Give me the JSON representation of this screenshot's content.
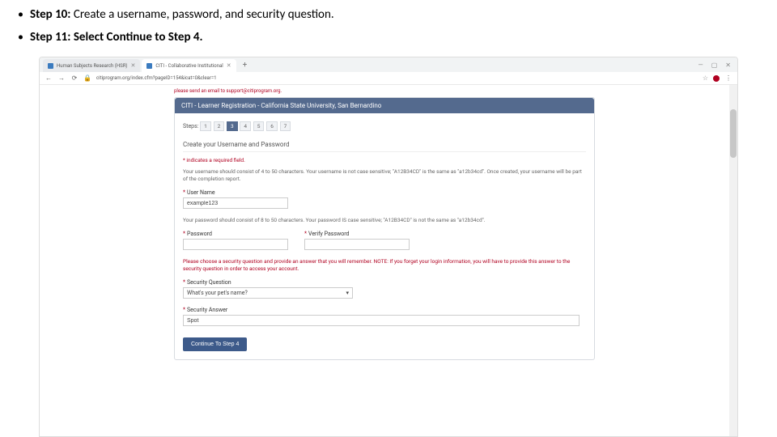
{
  "instructions": {
    "step10": {
      "label": "Step 10:",
      "text": " Create a username, password, and security question."
    },
    "step11": {
      "label": "Step 11: Select Continue to Step 4."
    }
  },
  "browser": {
    "tabs": [
      {
        "title": "Human Subjects Research (HSR)"
      },
      {
        "title": "CITI - Collaborative Institutional"
      }
    ],
    "url": "citiprogram.org/index.cfm?pageID=154&icat=0&clear=1",
    "win": {
      "min": "—",
      "max": "▢",
      "close": "✕"
    }
  },
  "page": {
    "top_alert": "please send an email to support@citiprogram.org.",
    "header": "CITI - Learner Registration - California State University, San Bernardino",
    "steps_label": "Steps:",
    "steps": [
      "1",
      "2",
      "3",
      "4",
      "5",
      "6",
      "7"
    ],
    "section_title": "Create your Username and Password",
    "required_note": "* indicates a required field.",
    "username_help": "Your username should consist of 4 to 50 characters. Your username is not case sensitive; \"A12B34CD\" is the same as \"a12b34cd\". Once created, your username will be part of the completion report.",
    "username_label": "User Name",
    "username_value": "example123",
    "password_help": "Your password should consist of 8 to 50 characters. Your password IS case sensitive; \"A12B34CD\" is not the same as \"a12b34cd\".",
    "password_label": "Password",
    "verify_password_label": "Verify Password",
    "security_help": "Please choose a security question and provide an answer that you will remember. NOTE: If you forget your login information, you will have to provide this answer to the security question in order to access your account.",
    "security_question_label": "Security Question",
    "security_question_value": "What's your pet's name?",
    "security_answer_label": "Security Answer",
    "security_answer_value": "Spot",
    "continue_button": "Continue To Step 4"
  }
}
